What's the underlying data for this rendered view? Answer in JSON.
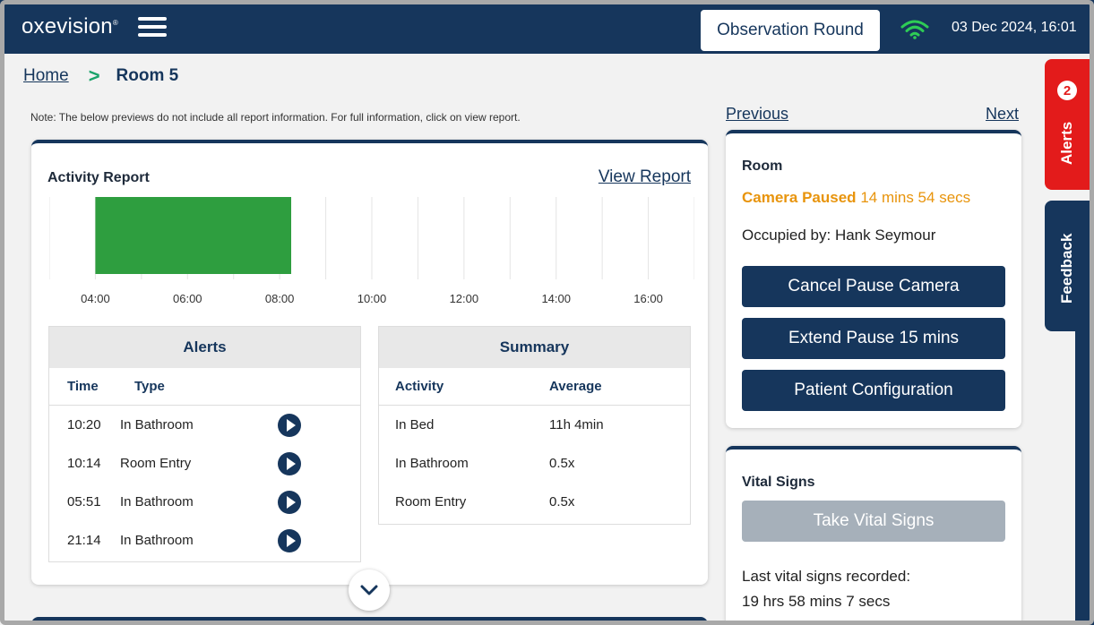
{
  "header": {
    "logo": "oxevision",
    "logo_mark": "®",
    "observation_round": "Observation Round",
    "datetime": "03 Dec 2024, 16:01"
  },
  "breadcrumb": {
    "home": "Home",
    "separator": ">",
    "current": "Room 5"
  },
  "note": "Note: The below previews do not include all report information. For full information, click on view report.",
  "activity": {
    "title": "Activity Report",
    "view_report": "View Report",
    "accent": "#2e9e3f"
  },
  "chart_data": {
    "type": "bar",
    "x_ticks": [
      "04:00",
      "06:00",
      "08:00",
      "10:00",
      "12:00",
      "14:00",
      "16:00"
    ],
    "x_range": [
      "03:00",
      "17:00"
    ],
    "series": [
      {
        "start": "04:00",
        "end": "08:15",
        "color": "#2e9e3f"
      }
    ]
  },
  "alerts_table": {
    "title": "Alerts",
    "columns": [
      "Time",
      "Type"
    ],
    "rows": [
      {
        "time": "10:20",
        "type": "In Bathroom"
      },
      {
        "time": "10:14",
        "type": "Room Entry"
      },
      {
        "time": "05:51",
        "type": "In Bathroom"
      },
      {
        "time": "21:14",
        "type": "In Bathroom"
      }
    ]
  },
  "summary_table": {
    "title": "Summary",
    "columns": [
      "Activity",
      "Average"
    ],
    "rows": [
      {
        "activity": "In Bed",
        "average": "11h 4min"
      },
      {
        "activity": "In Bathroom",
        "average": "0.5x"
      },
      {
        "activity": "Room Entry",
        "average": "0.5x"
      }
    ]
  },
  "nav": {
    "previous": "Previous",
    "next": "Next"
  },
  "room": {
    "title": "Room",
    "status": "Camera Paused",
    "status_time": "14 mins 54 secs",
    "status_color": "#e8940c",
    "occupied": "Occupied by: Hank Seymour",
    "buttons": [
      "Cancel Pause Camera",
      "Extend Pause 15 mins",
      "Patient Configuration"
    ]
  },
  "vitals": {
    "title": "Vital Signs",
    "button": "Take Vital Signs",
    "last_label": "Last vital signs recorded:",
    "last_value": "19 hrs 58 mins 7 secs"
  },
  "side_tabs": {
    "alerts": "Alerts",
    "alerts_count": "2",
    "feedback": "Feedback"
  }
}
